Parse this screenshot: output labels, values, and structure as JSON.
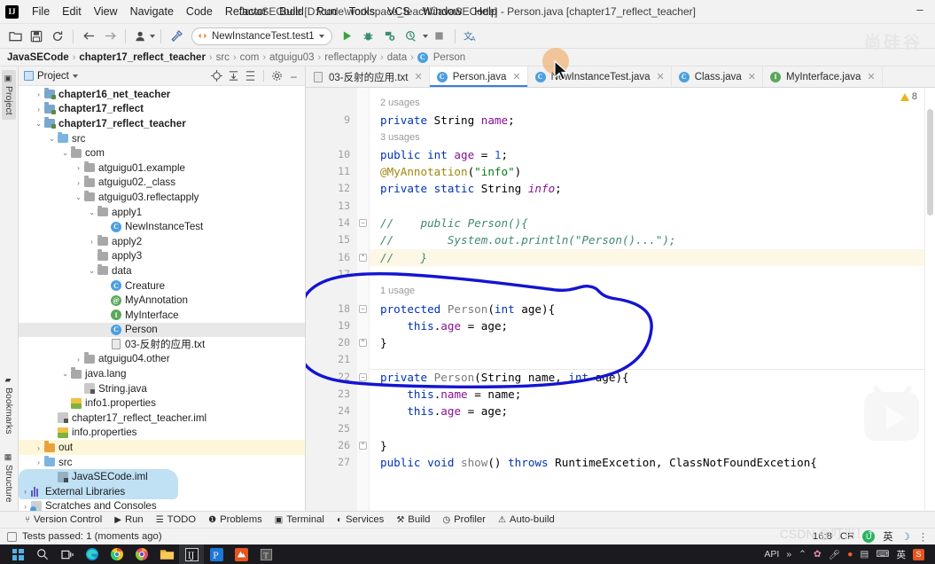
{
  "window": {
    "title": "JavaSECode [D:\\code\\workspace_teach\\JavaSECode] - Person.java [chapter17_reflect_teacher]",
    "logo": "IJ",
    "minimize": "–"
  },
  "menu": {
    "items": [
      "File",
      "Edit",
      "View",
      "Navigate",
      "Code",
      "Refactor",
      "Build",
      "Run",
      "Tools",
      "VCS",
      "Window",
      "Help"
    ]
  },
  "toolbar": {
    "open_icon": "folder-open-icon",
    "save_icon": "save-icon",
    "sync_icon": "sync-icon",
    "back_icon": "back-arrow-icon",
    "forward_icon": "forward-arrow-icon",
    "profile_icon": "user-profile-icon",
    "build_icon": "hammer-icon",
    "run_config": "NewInstanceTest.test1",
    "run_icon": "run-icon",
    "debug_icon": "debug-icon",
    "coverage_icon": "run-with-coverage-icon",
    "profiler_icon": "profile-icon",
    "stop_icon": "stop-icon",
    "translate_icon": "translate-icon"
  },
  "breadcrumb": {
    "items": [
      {
        "label": "JavaSECode",
        "bold": true
      },
      {
        "label": "chapter17_reflect_teacher",
        "bold": true
      },
      {
        "label": "src",
        "bold": false
      },
      {
        "label": "com",
        "bold": false
      },
      {
        "label": "atguigu03",
        "bold": false
      },
      {
        "label": "reflectapply",
        "bold": false
      },
      {
        "label": "data",
        "bold": false
      },
      {
        "label": "Person",
        "bold": false,
        "icon": "class-icon"
      }
    ],
    "separator": "›"
  },
  "left_strip": {
    "top_tab": "Project",
    "bottom_tabs": [
      "Bookmarks",
      "Structure"
    ]
  },
  "project_panel": {
    "title": "Project",
    "actions": [
      "locate-icon",
      "expand-all-icon",
      "collapse-all-icon",
      "settings-gear-icon",
      "hide-icon"
    ],
    "tree": [
      {
        "indent": 1,
        "arrow": "›",
        "icon": "module-icon",
        "label": "chapter16_net_teacher",
        "bold": true
      },
      {
        "indent": 1,
        "arrow": "›",
        "icon": "module-icon",
        "label": "chapter17_reflect",
        "bold": true
      },
      {
        "indent": 1,
        "arrow": "⌄",
        "icon": "module-icon",
        "label": "chapter17_reflect_teacher",
        "bold": true
      },
      {
        "indent": 2,
        "arrow": "⌄",
        "icon": "source-folder-icon",
        "label": "src",
        "bold": false
      },
      {
        "indent": 3,
        "arrow": "⌄",
        "icon": "package-icon",
        "label": "com",
        "bold": false
      },
      {
        "indent": 4,
        "arrow": "›",
        "icon": "package-icon",
        "label": "atguigu01.example",
        "bold": false
      },
      {
        "indent": 4,
        "arrow": "›",
        "icon": "package-icon",
        "label": "atguigu02._class",
        "bold": false
      },
      {
        "indent": 4,
        "arrow": "⌄",
        "icon": "package-icon",
        "label": "atguigu03.reflectapply",
        "bold": false
      },
      {
        "indent": 5,
        "arrow": "⌄",
        "icon": "package-icon",
        "label": "apply1",
        "bold": false
      },
      {
        "indent": 6,
        "arrow": "",
        "icon": "class-run-icon",
        "label": "NewInstanceTest",
        "bold": false
      },
      {
        "indent": 5,
        "arrow": "›",
        "icon": "package-icon",
        "label": "apply2",
        "bold": false
      },
      {
        "indent": 5,
        "arrow": "",
        "icon": "package-icon",
        "label": "apply3",
        "bold": false
      },
      {
        "indent": 5,
        "arrow": "⌄",
        "icon": "package-icon",
        "label": "data",
        "bold": false
      },
      {
        "indent": 6,
        "arrow": "",
        "icon": "class-icon",
        "label": "Creature",
        "bold": false
      },
      {
        "indent": 6,
        "arrow": "",
        "icon": "annotation-icon",
        "label": "MyAnnotation",
        "bold": false
      },
      {
        "indent": 6,
        "arrow": "",
        "icon": "interface-icon",
        "label": "MyInterface",
        "bold": false
      },
      {
        "indent": 6,
        "arrow": "",
        "icon": "class-icon",
        "label": "Person",
        "bold": false,
        "selected": true
      },
      {
        "indent": 6,
        "arrow": "",
        "icon": "text-file-icon",
        "label": "03-反射的应用.txt",
        "bold": false
      },
      {
        "indent": 4,
        "arrow": "›",
        "icon": "package-icon",
        "label": "atguigu04.other",
        "bold": false
      },
      {
        "indent": 3,
        "arrow": "⌄",
        "icon": "package-icon",
        "label": "java.lang",
        "bold": false
      },
      {
        "indent": 4,
        "arrow": "",
        "icon": "java-file-icon",
        "label": "String.java",
        "bold": false
      },
      {
        "indent": 3,
        "arrow": "",
        "icon": "properties-icon",
        "label": "info1.properties",
        "bold": false
      },
      {
        "indent": 2,
        "arrow": "",
        "icon": "iml-file-icon",
        "label": "chapter17_reflect_teacher.iml",
        "bold": false
      },
      {
        "indent": 2,
        "arrow": "",
        "icon": "properties-icon",
        "label": "info.properties",
        "bold": false
      },
      {
        "indent": 1,
        "arrow": "›",
        "icon": "output-folder-icon",
        "label": "out",
        "bold": false,
        "highlight": true
      },
      {
        "indent": 1,
        "arrow": "›",
        "icon": "source-folder-icon",
        "label": "src",
        "bold": false
      },
      {
        "indent": 2,
        "arrow": "",
        "icon": "iml-file-icon",
        "label": "JavaSECode.iml",
        "bold": false
      },
      {
        "indent": 0,
        "arrow": "›",
        "icon": "libraries-icon",
        "label": "External Libraries",
        "bold": false
      },
      {
        "indent": 0,
        "arrow": "›",
        "icon": "scratches-icon",
        "label": "Scratches and Consoles",
        "bold": false
      }
    ]
  },
  "editor_tabs": [
    {
      "label": "03-反射的应用.txt",
      "icon": "text-file-icon",
      "active": false
    },
    {
      "label": "Person.java",
      "icon": "class-icon",
      "active": true
    },
    {
      "label": "NewInstanceTest.java",
      "icon": "class-run-icon",
      "active": false
    },
    {
      "label": "Class.java",
      "icon": "class-icon",
      "active": false
    },
    {
      "label": "MyInterface.java",
      "icon": "interface-icon",
      "active": false
    }
  ],
  "editor": {
    "warning_count": "8",
    "warning_icon": "warning-triangle-icon",
    "lines": [
      {
        "num": "",
        "kind": "hint",
        "text": "2 usages"
      },
      {
        "num": "9",
        "kind": "code",
        "segs": [
          {
            "t": "private ",
            "c": "kw"
          },
          {
            "t": "String ",
            "c": "type"
          },
          {
            "t": "name",
            "c": "fld"
          },
          {
            "t": ";",
            "c": "type"
          }
        ]
      },
      {
        "num": "",
        "kind": "hint",
        "text": "3 usages"
      },
      {
        "num": "10",
        "kind": "code",
        "segs": [
          {
            "t": "public ",
            "c": "kw"
          },
          {
            "t": "int ",
            "c": "kw"
          },
          {
            "t": "age",
            "c": "fld"
          },
          {
            "t": " = ",
            "c": "type"
          },
          {
            "t": "1",
            "c": "num"
          },
          {
            "t": ";",
            "c": "type"
          }
        ]
      },
      {
        "num": "11",
        "kind": "code",
        "segs": [
          {
            "t": "@MyAnnotation",
            "c": "ann"
          },
          {
            "t": "(",
            "c": "type"
          },
          {
            "t": "\"info\"",
            "c": "str"
          },
          {
            "t": ")",
            "c": "type"
          }
        ]
      },
      {
        "num": "12",
        "kind": "code",
        "segs": [
          {
            "t": "private ",
            "c": "kw"
          },
          {
            "t": "static ",
            "c": "kw"
          },
          {
            "t": "String ",
            "c": "type"
          },
          {
            "t": "info",
            "c": "fldi"
          },
          {
            "t": ";",
            "c": "type"
          }
        ]
      },
      {
        "num": "13",
        "kind": "code",
        "segs": []
      },
      {
        "num": "14",
        "kind": "code",
        "fold": "minus",
        "segs": [
          {
            "t": "//    public Person(){",
            "c": "cmt"
          }
        ]
      },
      {
        "num": "15",
        "kind": "code",
        "segs": [
          {
            "t": "//        System.out.println(\"Person()...\");",
            "c": "cmt"
          }
        ]
      },
      {
        "num": "16",
        "kind": "code",
        "fold": "plus",
        "hl": true,
        "segs": [
          {
            "t": "//    }",
            "c": "cmt"
          }
        ]
      },
      {
        "num": "17",
        "kind": "code",
        "segs": []
      },
      {
        "num": "",
        "kind": "hint",
        "text": "1 usage",
        "sep": true
      },
      {
        "num": "18",
        "kind": "code",
        "fold": "minus",
        "segs": [
          {
            "t": "protected ",
            "c": "kw"
          },
          {
            "t": "Person",
            "c": "mth"
          },
          {
            "t": "(",
            "c": "type"
          },
          {
            "t": "int ",
            "c": "kw"
          },
          {
            "t": "age",
            "c": "type"
          },
          {
            "t": "){",
            "c": "type"
          }
        ]
      },
      {
        "num": "19",
        "kind": "code",
        "segs": [
          {
            "t": "    ",
            "c": "type"
          },
          {
            "t": "this",
            "c": "kw"
          },
          {
            "t": ".",
            "c": "type"
          },
          {
            "t": "age",
            "c": "fld"
          },
          {
            "t": " = age;",
            "c": "type"
          }
        ]
      },
      {
        "num": "20",
        "kind": "code",
        "fold": "plus",
        "segs": [
          {
            "t": "}",
            "c": "type"
          }
        ]
      },
      {
        "num": "21",
        "kind": "code",
        "segs": []
      },
      {
        "num": "22",
        "kind": "code",
        "fold": "minus",
        "sep": true,
        "segs": [
          {
            "t": "private ",
            "c": "kw"
          },
          {
            "t": "Person",
            "c": "mth"
          },
          {
            "t": "(",
            "c": "type"
          },
          {
            "t": "String ",
            "c": "type"
          },
          {
            "t": "name",
            "c": "type"
          },
          {
            "t": ", ",
            "c": "type"
          },
          {
            "t": "int ",
            "c": "kw"
          },
          {
            "t": "age",
            "c": "type"
          },
          {
            "t": "){",
            "c": "type"
          }
        ]
      },
      {
        "num": "23",
        "kind": "code",
        "segs": [
          {
            "t": "    ",
            "c": "type"
          },
          {
            "t": "this",
            "c": "kw"
          },
          {
            "t": ".",
            "c": "type"
          },
          {
            "t": "name",
            "c": "fld"
          },
          {
            "t": " = name;",
            "c": "type"
          }
        ]
      },
      {
        "num": "24",
        "kind": "code",
        "segs": [
          {
            "t": "    ",
            "c": "type"
          },
          {
            "t": "this",
            "c": "kw"
          },
          {
            "t": ".",
            "c": "type"
          },
          {
            "t": "age",
            "c": "fld"
          },
          {
            "t": " = age;",
            "c": "type"
          }
        ]
      },
      {
        "num": "25",
        "kind": "code",
        "segs": []
      },
      {
        "num": "26",
        "kind": "code",
        "fold": "plus",
        "segs": [
          {
            "t": "}",
            "c": "type"
          }
        ]
      },
      {
        "num": "27",
        "kind": "code",
        "clipped": true,
        "segs": [
          {
            "t": "public ",
            "c": "kw"
          },
          {
            "t": "void ",
            "c": "kw"
          },
          {
            "t": "show",
            "c": "mth"
          },
          {
            "t": "() ",
            "c": "type"
          },
          {
            "t": "throws ",
            "c": "kw"
          },
          {
            "t": "RuntimeExcetion, ClassNotFoundExcetion{",
            "c": "type"
          }
        ]
      }
    ]
  },
  "annotation": {
    "color": "#1414d2",
    "shape": "hand-drawn-ellipse around commented-out default constructor"
  },
  "tool_window_bar": {
    "items": [
      {
        "label": "Version Control",
        "icon": "branch-icon"
      },
      {
        "label": "Run",
        "icon": "run-icon"
      },
      {
        "label": "TODO",
        "icon": "todo-icon"
      },
      {
        "label": "Problems",
        "icon": "problems-icon"
      },
      {
        "label": "Terminal",
        "icon": "terminal-icon"
      },
      {
        "label": "Services",
        "icon": "services-icon"
      },
      {
        "label": "Build",
        "icon": "hammer-icon"
      },
      {
        "label": "Profiler",
        "icon": "profiler-icon"
      },
      {
        "label": "Auto-build",
        "icon": "auto-build-icon"
      }
    ]
  },
  "status_bar": {
    "message": "Tests passed: 1 (moments ago)",
    "message_icon": "test-passed-icon",
    "caret": "16:8",
    "line_sep": "CR",
    "ime_logo": "U",
    "ime_lang": "英",
    "moon_icon": "moon-icon"
  },
  "taskbar": {
    "items": [
      {
        "icon": "windows-start-icon"
      },
      {
        "icon": "search-icon"
      },
      {
        "icon": "task-view-icon"
      },
      {
        "icon": "edge-icon"
      },
      {
        "icon": "chrome-icon"
      },
      {
        "icon": "chrome-canary-icon"
      },
      {
        "icon": "file-explorer-icon"
      },
      {
        "icon": "intellij-idea-icon",
        "active": true
      },
      {
        "icon": "pycharm-icon"
      },
      {
        "icon": "notepadpp-icon"
      },
      {
        "icon": "typora-icon"
      }
    ],
    "tray": {
      "api_label": "API",
      "chevron": "⌃",
      "expand": "»",
      "icons": [
        "flower-icon",
        "mic-icon",
        "tomato-timer-icon",
        "clipboard-icon",
        "keyboard-icon",
        "ime-cn-icon",
        "sogou-icon"
      ]
    }
  },
  "watermarks": {
    "top_right": "尚硅谷",
    "csdn": "CSDN @叮当！*"
  }
}
